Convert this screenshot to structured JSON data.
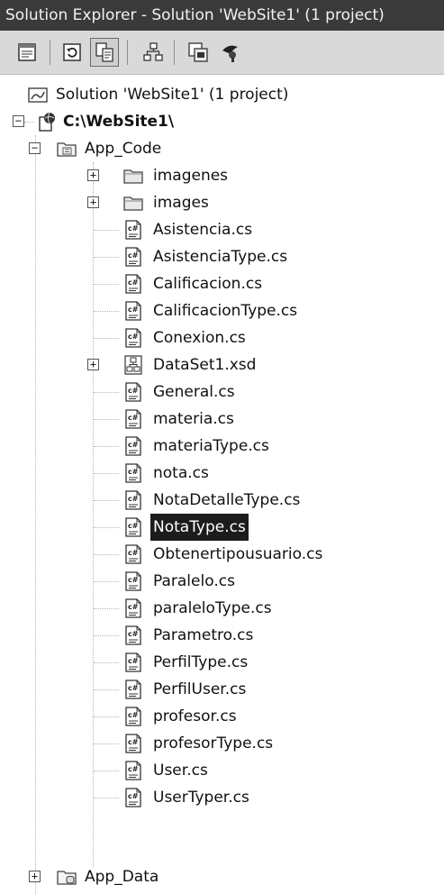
{
  "window": {
    "title": "Solution Explorer - Solution 'WebSite1' (1 project)"
  },
  "toolbar": {
    "buttons": [
      {
        "name": "properties-icon"
      },
      {
        "name": "refresh-icon"
      },
      {
        "name": "nest-related-files-icon",
        "pressed": true
      },
      {
        "name": "copy-website-icon"
      },
      {
        "name": "view-code-icon"
      },
      {
        "name": "asp-configuration-icon"
      }
    ]
  },
  "tree": {
    "solution": {
      "label": "Solution 'WebSite1' (1 project)"
    },
    "project": {
      "label": "C:\\WebSite1\\"
    },
    "app_code": {
      "label": "App_Code"
    },
    "folders": [
      {
        "label": "imagenes"
      },
      {
        "label": "images"
      }
    ],
    "files": [
      {
        "label": "Asistencia.cs",
        "icon": "cs-file-icon"
      },
      {
        "label": "AsistenciaType.cs",
        "icon": "cs-file-icon"
      },
      {
        "label": "Calificacion.cs",
        "icon": "cs-file-icon"
      },
      {
        "label": "CalificacionType.cs",
        "icon": "cs-file-icon"
      },
      {
        "label": "Conexion.cs",
        "icon": "cs-file-icon"
      },
      {
        "label": "DataSet1.xsd",
        "icon": "dataset-icon",
        "expandable": true
      },
      {
        "label": "General.cs",
        "icon": "cs-file-icon"
      },
      {
        "label": "materia.cs",
        "icon": "cs-file-icon"
      },
      {
        "label": "materiaType.cs",
        "icon": "cs-file-icon"
      },
      {
        "label": "nota.cs",
        "icon": "cs-file-icon"
      },
      {
        "label": "NotaDetalleType.cs",
        "icon": "cs-file-icon"
      },
      {
        "label": "NotaType.cs",
        "icon": "cs-file-icon",
        "selected": true
      },
      {
        "label": "Obtenertipousuario.cs",
        "icon": "cs-file-icon"
      },
      {
        "label": "Paralelo.cs",
        "icon": "cs-file-icon"
      },
      {
        "label": "paraleloType.cs",
        "icon": "cs-file-icon"
      },
      {
        "label": "Parametro.cs",
        "icon": "cs-file-icon"
      },
      {
        "label": "PerfilType.cs",
        "icon": "cs-file-icon"
      },
      {
        "label": "PerfilUser.cs",
        "icon": "cs-file-icon"
      },
      {
        "label": "profesor.cs",
        "icon": "cs-file-icon"
      },
      {
        "label": "profesorType.cs",
        "icon": "cs-file-icon"
      },
      {
        "label": "User.cs",
        "icon": "cs-file-icon"
      },
      {
        "label": "UserTyper.cs",
        "icon": "cs-file-icon"
      }
    ],
    "app_data": {
      "label": "App_Data"
    }
  },
  "colors": {
    "titlebar": "#3a3a3a",
    "toolbar": "#d9d9d9",
    "selection": "#1c1c1c"
  }
}
